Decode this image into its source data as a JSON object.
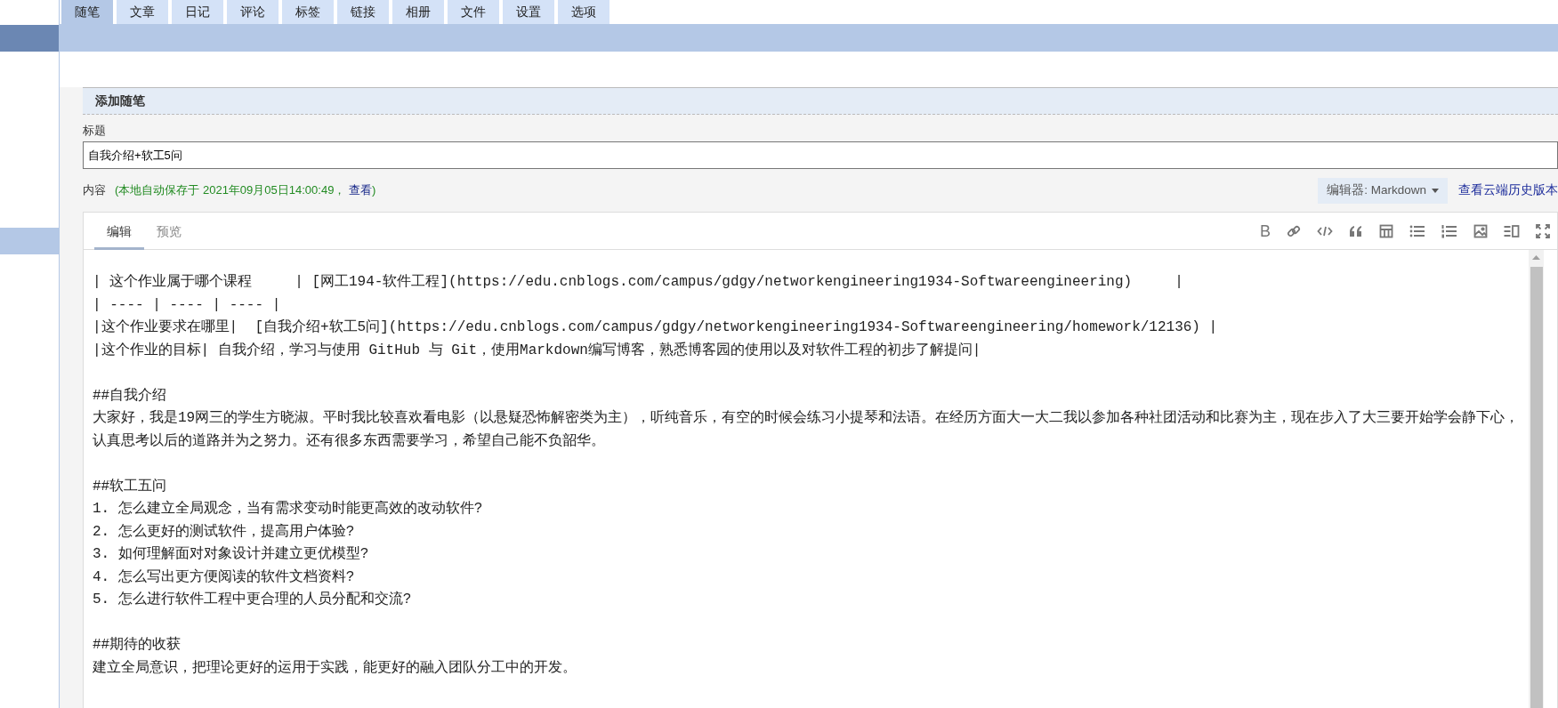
{
  "sidebar": {
    "items": [
      {
        "selected": false
      },
      {
        "selected": true
      }
    ]
  },
  "tabs": [
    {
      "label": "随笔",
      "selected": true
    },
    {
      "label": "文章",
      "selected": false
    },
    {
      "label": "日记",
      "selected": false
    },
    {
      "label": "评论",
      "selected": false
    },
    {
      "label": "标签",
      "selected": false
    },
    {
      "label": "链接",
      "selected": false
    },
    {
      "label": "相册",
      "selected": false
    },
    {
      "label": "文件",
      "selected": false
    },
    {
      "label": "设置",
      "selected": false
    },
    {
      "label": "选项",
      "selected": false
    }
  ],
  "section_title": "添加随笔",
  "title_field": {
    "label": "标题",
    "value": "自我介绍+软工5问"
  },
  "content": {
    "label": "内容",
    "autosave_prefix": "(本地自动保存于 2021年09月05日14:00:49，",
    "autosave_link": "查看",
    "autosave_suffix": ")",
    "editor_select": "编辑器: Markdown",
    "history_link": "查看云端历史版本"
  },
  "editor_tabs": [
    {
      "label": "编辑",
      "selected": true
    },
    {
      "label": "预览",
      "selected": false
    }
  ],
  "toolbar": [
    {
      "kind": "bold",
      "glyph": "B"
    },
    {
      "kind": "link"
    },
    {
      "kind": "code"
    },
    {
      "kind": "quote"
    },
    {
      "kind": "table"
    },
    {
      "kind": "bullet-list"
    },
    {
      "kind": "numbered-list"
    },
    {
      "kind": "image"
    },
    {
      "kind": "side-by-side"
    },
    {
      "kind": "fullscreen"
    }
  ],
  "editor_blocks": [
    [
      "| 这个作业属于哪个课程     | [网工194-软件工程](https://edu.cnblogs.com/campus/gdgy/networkengineering1934-Softwareengineering)     |",
      "| ---- | ---- | ---- |",
      "|这个作业要求在哪里|  [自我介绍+软工5问](https://edu.cnblogs.com/campus/gdgy/networkengineering1934-Softwareengineering/homework/12136) |",
      "|这个作业的目标| 自我介绍，学习与使用 GitHub 与 Git，使用Markdown编写博客，熟悉博客园的使用以及对软件工程的初步了解提问|"
    ],
    [
      "##自我介绍",
      "大家好，我是19网三的学生方晓淑。平时我比较喜欢看电影（以悬疑恐怖解密类为主），听纯音乐，有空的时候会练习小提琴和法语。在经历方面大一大二我以参加各种社团活动和比赛为主，现在步入了大三要开始学会静下心，认真思考以后的道路并为之努力。还有很多东西需要学习，希望自己能不负韶华。"
    ],
    [
      "##软工五问",
      "1. 怎么建立全局观念，当有需求变动时能更高效的改动软件?",
      "2. 怎么更好的测试软件，提高用户体验?",
      "3. 如何理解面对对象设计并建立更优模型?",
      "4. 怎么写出更方便阅读的软件文档资料?",
      "5. 怎么进行软件工程中更合理的人员分配和交流?"
    ],
    [
      "##期待的收获",
      "建立全局意识，把理论更好的运用于实践，能更好的融入团队分工中的开发。"
    ]
  ]
}
